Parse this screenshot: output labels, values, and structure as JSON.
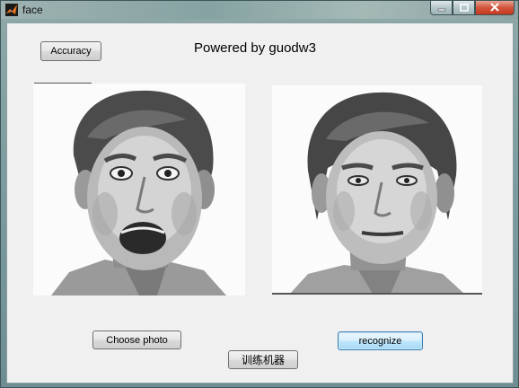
{
  "window": {
    "title": "face"
  },
  "main": {
    "accuracy_button": "Accuracy",
    "powered_text": "Powered by guodw3",
    "choose_photo_button": "Choose photo",
    "recognize_button": "recognize",
    "train_button": "训练机器"
  },
  "images": {
    "left_photo": "surprised-face-photo",
    "right_photo": "neutral-face-photo"
  },
  "colors": {
    "client_bg": "#f0f0f0",
    "focus_border": "#3c7fb1",
    "close_button": "#c5391f"
  }
}
